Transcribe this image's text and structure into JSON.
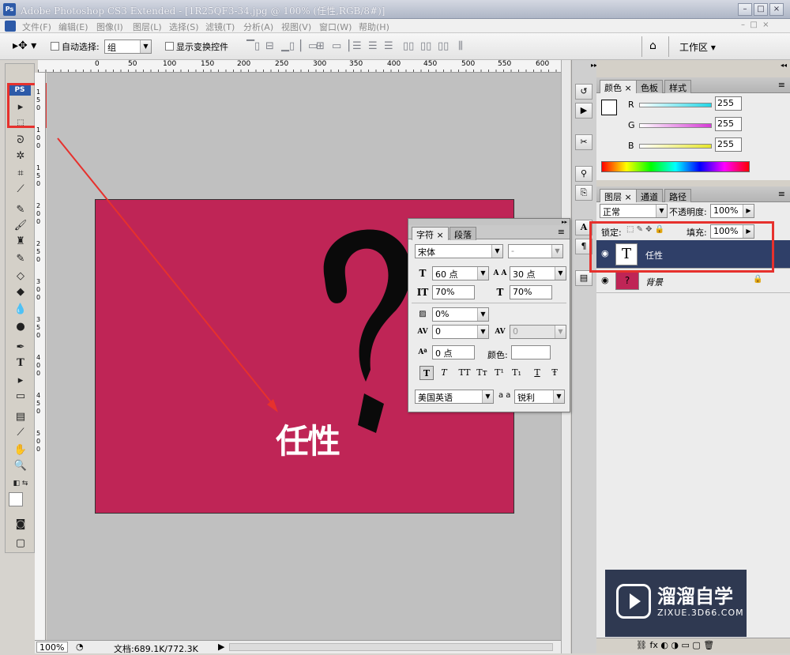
{
  "window": {
    "title": "Adobe Photoshop CS3 Extended - [1R25QF3-34.jpg @ 100% (任性,RGB/8#)]",
    "app_badge": "Ps"
  },
  "menu": [
    "文件(F)",
    "编辑(E)",
    "图像(I)",
    "图层(L)",
    "选择(S)",
    "滤镜(T)",
    "分析(A)",
    "视图(V)",
    "窗口(W)",
    "帮助(H)"
  ],
  "options": {
    "auto_select_label": "自动选择:",
    "auto_select_value": "组",
    "show_transform_label": "显示变换控件",
    "workspace_label": "工作区 ▾"
  },
  "ruler": {
    "h_ticks": [
      "0",
      "50",
      "100",
      "150",
      "200",
      "250",
      "300",
      "350",
      "400",
      "450",
      "500",
      "550",
      "600"
    ],
    "v_ticks": [
      "1",
      "5",
      "0",
      "1",
      "0",
      "0",
      "1",
      "5",
      "0",
      "2",
      "0",
      "0",
      "2",
      "5",
      "0",
      "3",
      "0",
      "0",
      "3",
      "5",
      "0",
      "4",
      "0",
      "0",
      "4",
      "5",
      "0",
      "5",
      "0",
      "0"
    ]
  },
  "document": {
    "text": "任性",
    "bg_color": "#bf2556"
  },
  "status": {
    "zoom": "100%",
    "doc_info": "文档:689.1K/772.3K"
  },
  "color_panel": {
    "tabs": [
      "颜色",
      "色板",
      "样式"
    ],
    "channels": [
      {
        "label": "R",
        "value": "255",
        "color": "#22d6e6"
      },
      {
        "label": "G",
        "value": "255",
        "color": "#d63ad6"
      },
      {
        "label": "B",
        "value": "255",
        "color": "#e6e62a"
      }
    ]
  },
  "layers_panel": {
    "tabs": [
      "图层",
      "通道",
      "路径"
    ],
    "blend_mode": "正常",
    "opacity_label": "不透明度:",
    "opacity": "100%",
    "lock_label": "锁定:",
    "fill_label": "填充:",
    "fill": "100%",
    "layers": [
      {
        "name": "任性",
        "thumb": "T",
        "selected": true
      },
      {
        "name": "背景",
        "thumb": "",
        "selected": false
      }
    ]
  },
  "character_panel": {
    "tabs": [
      "字符",
      "段落"
    ],
    "font_family": "宋体",
    "font_style": "-",
    "font_size": "60 点",
    "leading": "30 点",
    "vertical_scale": "70%",
    "horizontal_scale": "70%",
    "tsume": "0%",
    "kerning": "0",
    "tracking": "0",
    "baseline_shift": "0 点",
    "color_label": "颜色:",
    "language": "美国英语",
    "aa_label": "a a",
    "antialias": "锐利",
    "format_buttons": [
      "T",
      "T",
      "TT",
      "Tт",
      "T¹",
      "T₁",
      "T",
      "Ŧ"
    ]
  },
  "watermark": {
    "title": "溜溜自学",
    "url": "ZIXUE.3D66.COM"
  }
}
